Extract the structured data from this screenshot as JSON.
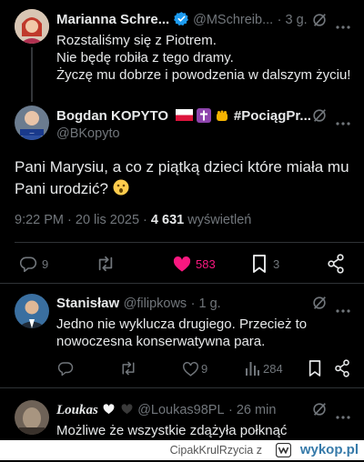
{
  "thread": {
    "tweet1": {
      "author_name": "Marianna Schre...",
      "handle": "@MSchreib...",
      "time": "· 3 g.",
      "lines": [
        "Rozstaliśmy się z Piotrem.",
        "Nie będę robiła z tego dramy.",
        "Życzę mu dobrze i powodzenia w dalszym życiu!"
      ]
    },
    "main": {
      "author_name": "Bogdan KOPYTO",
      "tag": "#PociągPr...",
      "handle": "@BKopyto",
      "text_line1": "Pani Marysiu, a co z piątką dzieci które miała mu",
      "text_line2": "Pani urodzić?",
      "time": "9:22 PM · 20 lis 2025 ·",
      "views_count": "4 631",
      "views_label": "wyświetleń",
      "replies": "9",
      "likes": "583",
      "bookmarks": "3"
    },
    "reply1": {
      "author_name": "Stanisław",
      "handle": "@filipkows",
      "time": "· 1 g.",
      "line1": "Jedno nie wyklucza drugiego. Przecież to",
      "line2": "nowoczesna konserwatywna para.",
      "likes": "9",
      "views": "284"
    },
    "reply2": {
      "author_name": "Loukas",
      "handle": "@Loukas98PL",
      "time": "· 26 min",
      "line1": "Możliwe że wszystkie zdążyła połknąć"
    }
  },
  "footer": {
    "user": "CipakKrulRzycia",
    "suffix": "z",
    "brand": "wykop.pl"
  },
  "colors": {
    "accent": "#1d9bf0",
    "like": "#f91880",
    "muted": "#71767b",
    "text": "#e7e9ea",
    "brand_blue": "#367aa9"
  }
}
